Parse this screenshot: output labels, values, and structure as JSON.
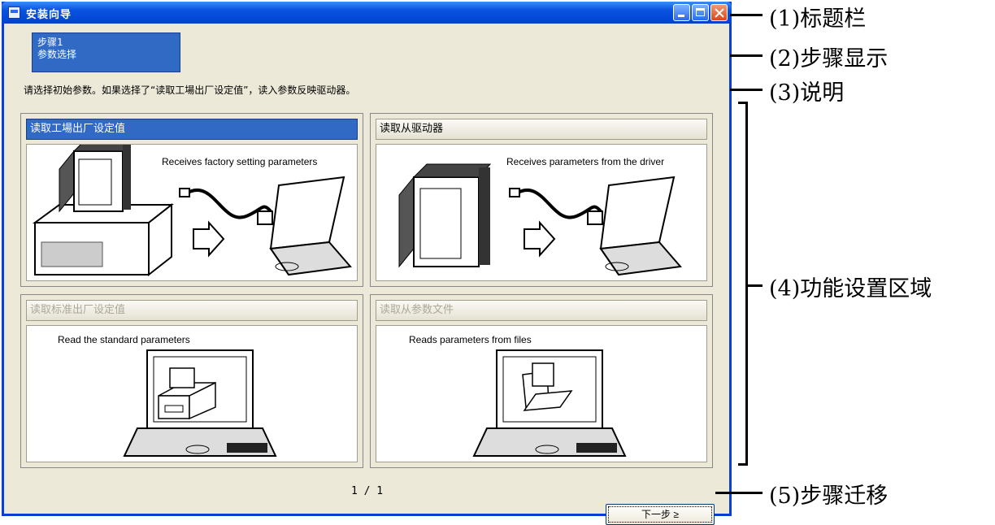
{
  "window": {
    "title": "安装向导"
  },
  "step": {
    "line1": "步骤1",
    "line2": "参数选择"
  },
  "instruction": "请选择初始参数。如果选择了“读取工場出厂设定值”，读入参数反映驱动器。",
  "panels": [
    {
      "label": "读取工場出厂设定值",
      "caption": "Receives factory setting parameters",
      "state": "selected"
    },
    {
      "label": "读取从驱动器",
      "caption": "Receives parameters from the driver",
      "state": "enabled"
    },
    {
      "label": "读取标准出厂设定值",
      "caption": "Read the standard parameters",
      "state": "disabled"
    },
    {
      "label": "读取从参数文件",
      "caption": "Reads parameters from files",
      "state": "disabled"
    }
  ],
  "pager": "1 / 1",
  "next_button": "下一步 ≥",
  "callouts": [
    "(1)标题栏",
    "(2)步骤显示",
    "(3)说明",
    "(4)功能设置区域",
    "(5)步骤迁移"
  ],
  "colors": {
    "titlebar": "#0a52e0",
    "selected": "#316ac5",
    "dialog_bg": "#ece9d8"
  }
}
